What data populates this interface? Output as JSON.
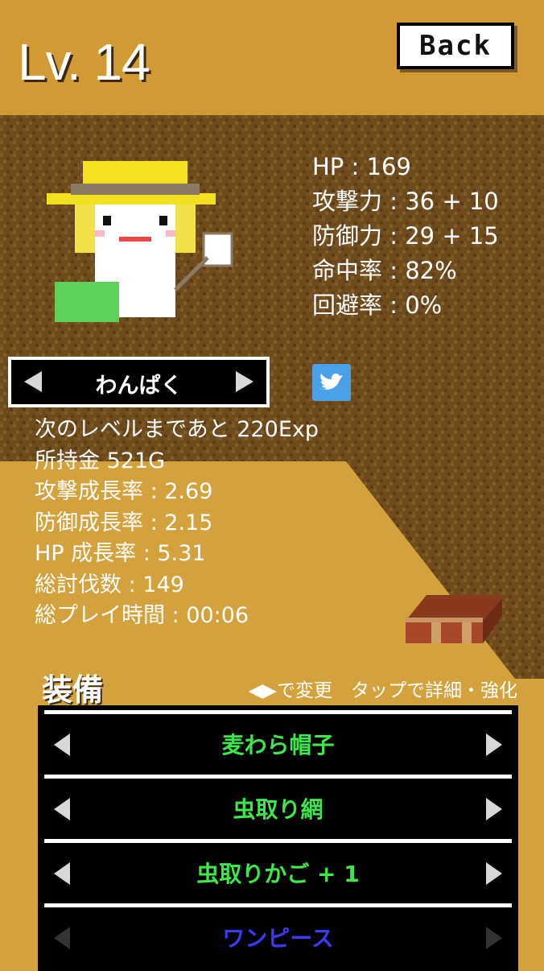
{
  "header": {
    "level": "Lv. 14",
    "back_label": "Back"
  },
  "stats": [
    "HP : 169",
    "攻撃力 : 36 + 10",
    "防御力 : 29 + 15",
    "命中率 : 82%",
    "回避率 : 0%"
  ],
  "personality": {
    "label": "わんぱく"
  },
  "info": [
    "次のレベルまであと 220Exp",
    "所持金 521G",
    "攻撃成長率 : 2.69",
    "防御成長率 : 2.15",
    "HP 成長率 : 5.31",
    "総討伐数 : 149",
    "総プレイ時間 : 00:06"
  ],
  "equipment": {
    "title": "装備",
    "hint": "◀▶で変更　タップで詳細・強化",
    "items": [
      {
        "label": "麦わら帽子",
        "color": "#3ee84a"
      },
      {
        "label": "虫取り網",
        "color": "#3ee84a"
      },
      {
        "label": "虫取りかご + 1",
        "color": "#3ee84a"
      },
      {
        "label": "ワンピース",
        "color": "#3a3af0"
      }
    ]
  },
  "colors": {
    "header_bg": "#d19a35",
    "dirt_bg": "#6e4a1c",
    "sand_bg": "#d4a23c"
  },
  "icons": {
    "twitter": "twitter-bird-icon",
    "chest": "treasure-chest-icon"
  }
}
